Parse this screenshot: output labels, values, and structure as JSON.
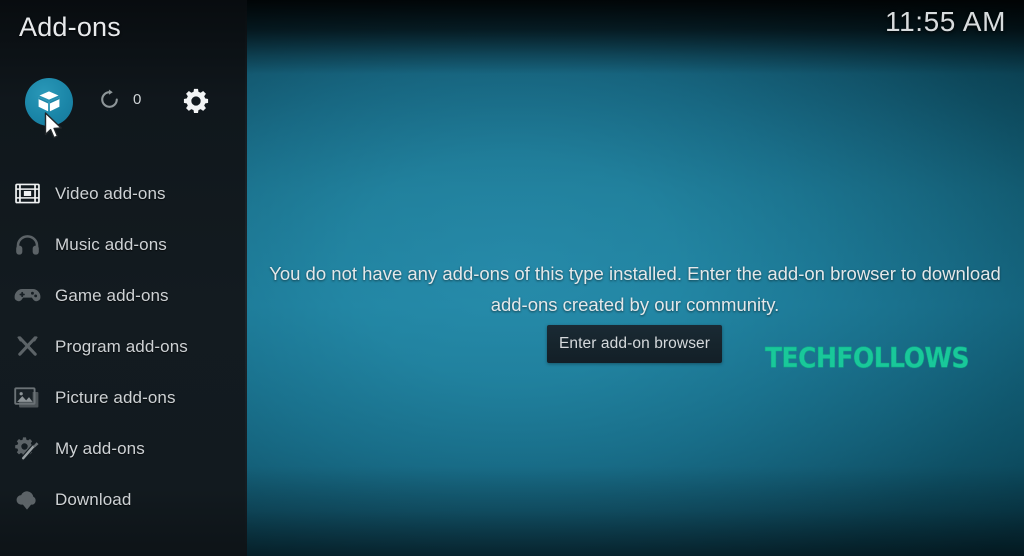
{
  "window": {
    "title": "Add-ons",
    "clock": "11:55 AM"
  },
  "colors": {
    "accent_teal": "#1b86a8",
    "sidebar_bg": "#131b20",
    "main_bg_center": "#175d77",
    "main_bg_edge": "#04202a",
    "text_primary": "#e4e8ea",
    "text_menu": "#ced2d5",
    "button_bg": "#16242c",
    "watermark": "#19c89a"
  },
  "toolbar": {
    "addon_box_icon": "open-box-icon",
    "refresh_icon": "refresh-icon",
    "refresh_count": "0",
    "settings_icon": "gear-icon"
  },
  "sidebar": {
    "items": [
      {
        "label": "Video add-ons",
        "icon": "film-strip-icon"
      },
      {
        "label": "Music add-ons",
        "icon": "headphones-icon"
      },
      {
        "label": "Game add-ons",
        "icon": "gamepad-icon"
      },
      {
        "label": "Program add-ons",
        "icon": "screwdriver-wrench-icon"
      },
      {
        "label": "Picture add-ons",
        "icon": "photo-stack-icon"
      },
      {
        "label": "My add-ons",
        "icon": "gear-screwdriver-icon"
      },
      {
        "label": "Download",
        "icon": "cloud-download-icon"
      }
    ]
  },
  "main": {
    "empty_message": "You do not have any add-ons of this type installed. Enter the add-on browser to download add-ons created by our community.",
    "enter_browser_label": "Enter add-on browser"
  },
  "watermark": {
    "text": "TECHFOLLOWS"
  },
  "cursor": {
    "icon": "arrow-pointer-cursor"
  }
}
